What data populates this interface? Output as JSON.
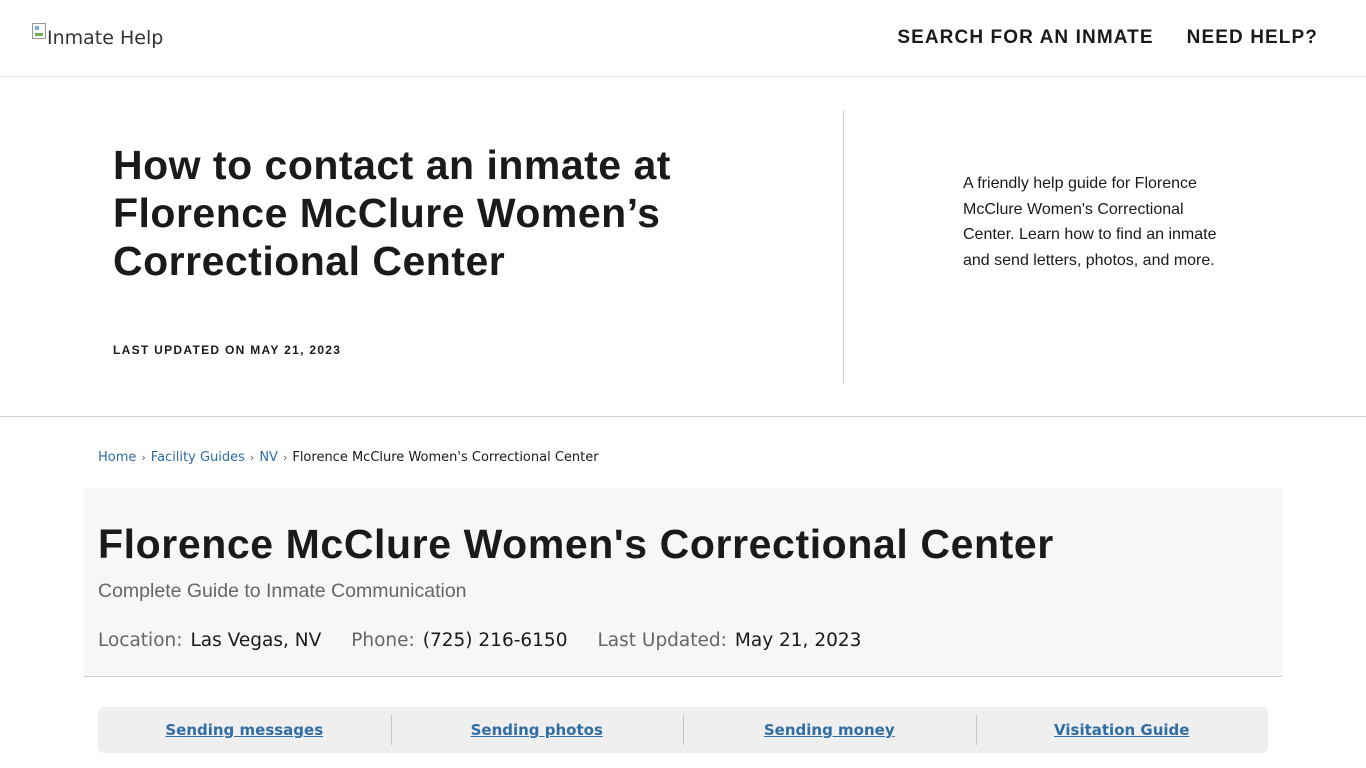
{
  "header": {
    "logo_alt": "Inmate Help",
    "logo_icon": "broken-image-icon",
    "nav": [
      {
        "label": "SEARCH FOR AN INMATE"
      },
      {
        "label": "NEED HELP?"
      }
    ]
  },
  "hero": {
    "title": "How to contact an inmate at Florence McClure Women’s Correctional Center",
    "updated": "LAST UPDATED ON MAY 21, 2023",
    "description": "A friendly help guide for Florence McClure Women's Correctional Center. Learn how to find an inmate and send letters, photos, and more."
  },
  "breadcrumb": {
    "separator": "›",
    "items": [
      {
        "label": "Home"
      },
      {
        "label": "Facility Guides"
      },
      {
        "label": "NV"
      }
    ],
    "current": "Florence McClure Women's Correctional Center"
  },
  "facility": {
    "title": "Florence McClure Women's Correctional Center",
    "subtitle": "Complete Guide to Inmate Communication",
    "location_label": "Location:",
    "location_value": "Las Vegas, NV",
    "phone_label": "Phone:",
    "phone_value": "(725) 216-6150",
    "updated_label": "Last Updated:",
    "updated_value": "May 21, 2023"
  },
  "tabs": [
    {
      "label": "Sending messages"
    },
    {
      "label": "Sending photos"
    },
    {
      "label": "Sending money"
    },
    {
      "label": "Visitation Guide"
    }
  ],
  "colors": {
    "link": "#2f6ea5",
    "panel_bg": "#f5f7f9",
    "tabs_bg": "#efefef",
    "text": "#1a1a1a"
  }
}
